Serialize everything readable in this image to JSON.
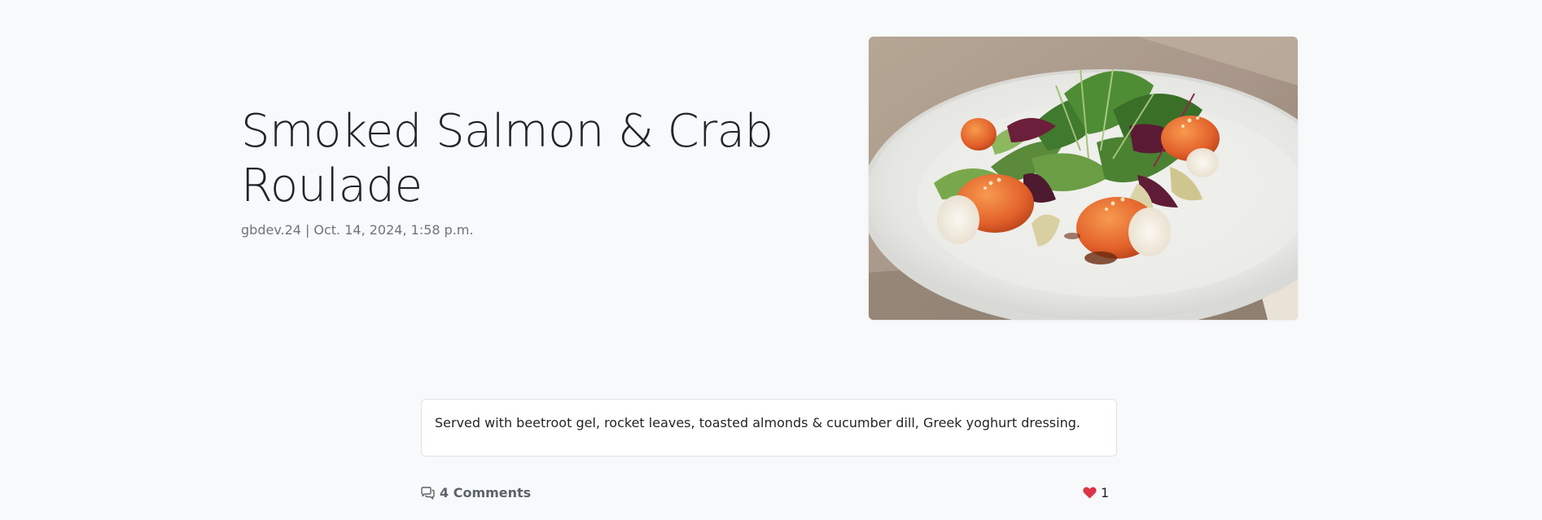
{
  "post": {
    "title": "Smoked Salmon & Crab Roulade",
    "author": "gbdev.24",
    "separator": "|",
    "date": "Oct. 14, 2024, 1:58 p.m.",
    "image_alt": "Smoked Salmon & Crab Roulade",
    "content": "Served with beetroot gel, rocket leaves, toasted almonds & cucumber dill, Greek yoghurt dressing."
  },
  "engagement": {
    "comments_label": "4 Comments",
    "comments_icon": "chat-bubbles-icon",
    "likes_count": "1",
    "likes_icon": "heart-icon",
    "like_color": "#dc3545"
  },
  "colors": {
    "background": "#f8f9fa",
    "muted_text": "#6c757d",
    "card_border": "#dee2e6"
  }
}
